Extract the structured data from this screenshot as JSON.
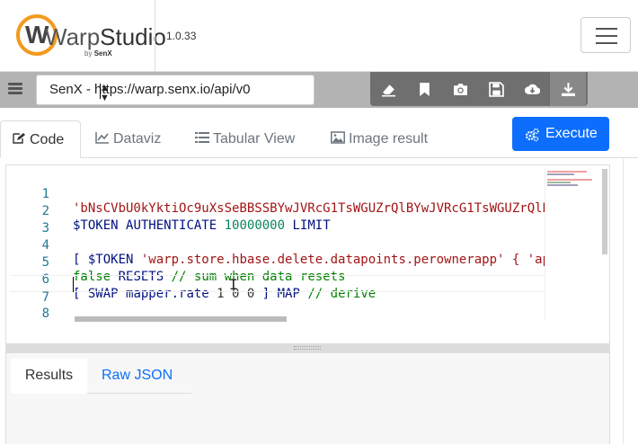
{
  "app": {
    "logo_prefix": "Warp",
    "logo_suffix": "Studio",
    "logo_by": "by",
    "logo_brand": "SenX",
    "version": "1.0.33"
  },
  "toolbar": {
    "endpoint": "SenX - https://warp.senx.io/api/v0",
    "tools": [
      "eraser-icon",
      "bookmark-icon",
      "camera-icon",
      "save-icon",
      "cloud-download-icon",
      "download-icon"
    ]
  },
  "tabs": {
    "code": "Code",
    "dataviz": "Dataviz",
    "tabular": "Tabular View",
    "image": "Image result"
  },
  "execute_label": "Execute",
  "editor": {
    "line_numbers": [
      "1",
      "2",
      "3",
      "4",
      "5",
      "6",
      "7",
      "8"
    ],
    "lines": {
      "l1": "'bNsCVbU0kYktiOc9uXsSeBBSSBYwJVRcG1TsWGUZrQlBYwJVRcG1TsWGUZrQlB",
      "l2_var": "$TOKEN",
      "l2_fn": "AUTHENTICATE",
      "l2_num": "10000000",
      "l2_fn2": "LIMIT",
      "l4_open": "[ ",
      "l4_var": "$TOKEN",
      "l4_str": "'warp.store.hbase.delete.datapoints.perownerapp'",
      "l4_rest": " { 'ap",
      "l5_kw": "false",
      "l5_fn": "RESETS",
      "l5_com": "// sum when data resets",
      "l6_open": "[ ",
      "l6_fn": "SWAP",
      "l6_mapper": "mapper.rate",
      "l6_nums": "1 0 0",
      "l6_close": " ] ",
      "l6_map": "MAP",
      "l6_com": "// derive"
    }
  },
  "results_tabs": {
    "results": "Results",
    "raw": "Raw JSON"
  },
  "colors": {
    "accent": "#0d6efd",
    "logo_ring": "#f39a1e",
    "toolbar_bg": "#b3b3b3",
    "tools_bg": "#6f6f6f"
  }
}
